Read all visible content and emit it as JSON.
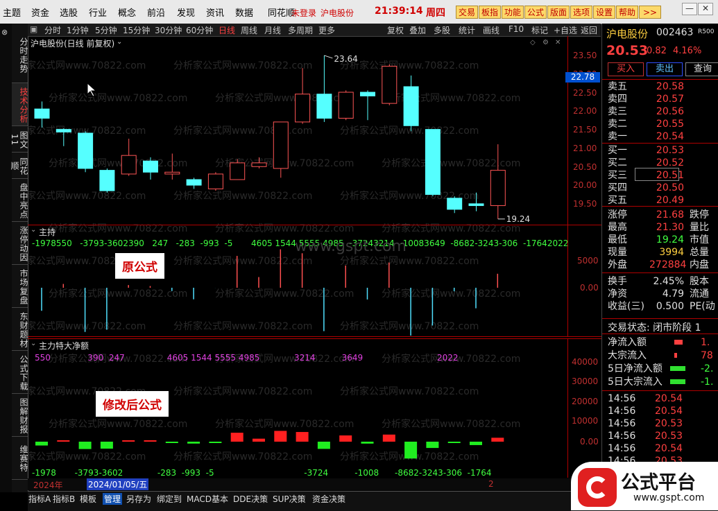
{
  "menu": {
    "items": [
      "主题",
      "资金",
      "选股",
      "行业",
      "概念",
      "前沿",
      "发现",
      "资讯",
      "数据",
      "同花顺"
    ],
    "login": "未登录",
    "stock": "沪电股份",
    "time": "21:39:14",
    "weekday": "周四",
    "buttons": [
      "交易",
      "板指",
      "功能",
      "公式",
      "版面",
      "选项",
      "设置",
      "帮助",
      ">>"
    ]
  },
  "toolbar": {
    "items": [
      "分时",
      "1分钟",
      "5分钟",
      "15分钟",
      "30分钟",
      "60分钟",
      "日线",
      "周线",
      "月线",
      "多周期",
      "更多"
    ],
    "right_items": [
      "复权",
      "叠加",
      "多股",
      "统计",
      "画线",
      "F10",
      "标记",
      "+自选",
      "返回"
    ]
  },
  "left_tabs": [
    "分时走势",
    "技术分析",
    "图文11",
    "同花顺",
    "盘中亮点",
    "涨停动因",
    "市场复盘",
    "东财题材",
    "公式下载",
    "图解财报",
    "维赛特"
  ],
  "kline": {
    "title": "沪电股份(日线 前复权)",
    "high_label": "23.64",
    "low_label": "19.24",
    "current_price_tag": "22.78",
    "yaxis": [
      "23.50",
      "23.00",
      "22.50",
      "22.00",
      "21.50",
      "21.00",
      "20.50",
      "20.00",
      "19.50"
    ]
  },
  "pane1": {
    "title": "主持",
    "values_line": "-1978550   -3793-3602390   247   -283  -993  -5       4605 1544 5555 4985  -37243214  -10083649  -8682-3243-306  -17642022",
    "label": "原公式",
    "yaxis": [
      "5000",
      "0.00"
    ]
  },
  "pane2": {
    "title": "主力特大净额",
    "top_values": "550              390  247                4605 1544 5555 4985             3214          3649                            2022",
    "bottom_values": "-1978       -3793-3602             -283  -993  -5                                  -3724          -1008      -8682-3243-306  -1764",
    "label": "修改后公式",
    "yaxis": [
      "40000",
      "30000",
      "20000",
      "10000",
      "0.00"
    ]
  },
  "date_bar": {
    "year": "2024年",
    "date": "2024/01/05/五",
    "end_mark": "2"
  },
  "watermark": "分析家公式网www.70822.com",
  "gspt": "www.gspt.com",
  "right_panel": {
    "name": "沪电股份",
    "code": "002463",
    "tag": "R500",
    "price": "20.53",
    "change": "0.82",
    "change_pct": "4.16%",
    "buy_btn": "买入",
    "sell_btn": "卖出",
    "query_btn": "查询",
    "asks": [
      [
        "卖五",
        "20.58"
      ],
      [
        "卖四",
        "20.57"
      ],
      [
        "卖三",
        "20.56"
      ],
      [
        "卖二",
        "20.55"
      ],
      [
        "卖一",
        "20.54"
      ]
    ],
    "bids": [
      [
        "买一",
        "20.53"
      ],
      [
        "买二",
        "20.52"
      ],
      [
        "买三",
        "20.51"
      ],
      [
        "买四",
        "20.50"
      ],
      [
        "买五",
        "20.49"
      ]
    ],
    "stats": [
      [
        "涨停",
        "21.68",
        "跌停"
      ],
      [
        "最高",
        "21.30",
        "量比"
      ],
      [
        "最低",
        "19.24",
        "市值"
      ],
      [
        "现量",
        "3994",
        "总量"
      ],
      [
        "外盘",
        "272884",
        "内盘"
      ]
    ],
    "stats2": [
      [
        "换手",
        "2.45%",
        "股本"
      ],
      [
        "净资",
        "4.79",
        "流通"
      ],
      [
        "收益(三)",
        "0.500",
        "PE(动"
      ]
    ],
    "trade_status": "交易状态: 闭市阶段 1",
    "flow": [
      [
        "净流入额",
        "1."
      ],
      [
        "大宗流入",
        "78"
      ],
      [
        "5日净流入额",
        "-2."
      ],
      [
        "5日大宗流入",
        "-1."
      ]
    ],
    "ticks": [
      [
        "14:56",
        "20.54"
      ],
      [
        "14:56",
        "20.54"
      ],
      [
        "14:56",
        "20.53"
      ],
      [
        "14:56",
        "20.53"
      ],
      [
        "14:56",
        "20.54"
      ],
      [
        "14:56",
        "20.53"
      ]
    ]
  },
  "bottom_tabs": [
    "指标A",
    "指标B",
    "模板",
    "管理",
    "另存为",
    "绑定到",
    "MACD基本",
    "DDE决策",
    "SUP决策",
    "资金决策"
  ],
  "logo": {
    "title": "公式平台",
    "url": "www.gspt.com"
  },
  "colors": {
    "up": "#ff5555",
    "down": "#55ffff",
    "bar_up": "#ff2020",
    "bar_down": "#20ee20"
  },
  "chart_data": {
    "type": "candlestick",
    "candles": [
      {
        "o": 21.95,
        "c": 22.2,
        "h": 22.4,
        "l": 21.7,
        "dir": "down"
      },
      {
        "o": 21.65,
        "c": 21.58,
        "h": 21.68,
        "l": 21.2,
        "dir": "down"
      },
      {
        "o": 21.55,
        "c": 20.6,
        "h": 21.6,
        "l": 20.5,
        "dir": "down"
      },
      {
        "o": 20.55,
        "c": 20.0,
        "h": 20.6,
        "l": 19.95,
        "dir": "down"
      },
      {
        "o": 20.45,
        "c": 20.95,
        "h": 21.4,
        "l": 20.4,
        "dir": "up"
      },
      {
        "o": 20.8,
        "c": 20.5,
        "h": 20.9,
        "l": 20.3,
        "dir": "down"
      },
      {
        "o": 20.45,
        "c": 20.5,
        "h": 21.0,
        "l": 20.3,
        "dir": "up"
      },
      {
        "o": 20.3,
        "c": 20.15,
        "h": 20.35,
        "l": 20.05,
        "dir": "down"
      },
      {
        "o": 20.05,
        "c": 20.45,
        "h": 20.5,
        "l": 20.0,
        "dir": "up"
      },
      {
        "o": 20.3,
        "c": 20.75,
        "h": 20.85,
        "l": 20.3,
        "dir": "up"
      },
      {
        "o": 20.65,
        "c": 20.75,
        "h": 20.9,
        "l": 20.6,
        "dir": "up"
      },
      {
        "o": 20.6,
        "c": 21.85,
        "h": 21.85,
        "l": 20.35,
        "dir": "up"
      },
      {
        "o": 21.85,
        "c": 22.6,
        "h": 23.3,
        "l": 21.8,
        "dir": "up"
      },
      {
        "o": 22.6,
        "c": 21.95,
        "h": 23.64,
        "l": 21.85,
        "dir": "down"
      },
      {
        "o": 21.95,
        "c": 22.65,
        "h": 22.7,
        "l": 21.9,
        "dir": "up"
      },
      {
        "o": 22.65,
        "c": 22.55,
        "h": 22.7,
        "l": 21.9,
        "dir": "down"
      },
      {
        "o": 22.35,
        "c": 23.35,
        "h": 23.4,
        "l": 22.3,
        "dir": "up"
      },
      {
        "o": 22.8,
        "c": 21.75,
        "h": 23.1,
        "l": 21.6,
        "dir": "down"
      },
      {
        "o": 21.65,
        "c": 19.9,
        "h": 21.65,
        "l": 19.85,
        "dir": "down"
      },
      {
        "o": 19.8,
        "c": 19.5,
        "h": 19.85,
        "l": 19.4,
        "dir": "down"
      },
      {
        "o": 19.65,
        "c": 19.6,
        "h": 19.95,
        "l": 19.45,
        "dir": "down"
      },
      {
        "o": 19.6,
        "c": 20.55,
        "h": 21.25,
        "l": 19.24,
        "dir": "up"
      }
    ],
    "pane1_values": [
      -1978,
      550,
      -3793,
      -3602,
      390,
      247,
      -283,
      -993,
      -5,
      4605,
      1544,
      5555,
      4985,
      -3724,
      3214,
      -1008,
      3649,
      -8682,
      -3243,
      -306,
      -1764,
      2022
    ],
    "pane2_values": [
      -1978,
      550,
      -3793,
      -3602,
      390,
      247,
      -283,
      -993,
      -5,
      4605,
      1544,
      5555,
      4985,
      -3724,
      3214,
      -1008,
      3649,
      -8682,
      -3243,
      -306,
      -1764,
      2022
    ],
    "ylim_price": [
      19.24,
      23.64
    ]
  }
}
